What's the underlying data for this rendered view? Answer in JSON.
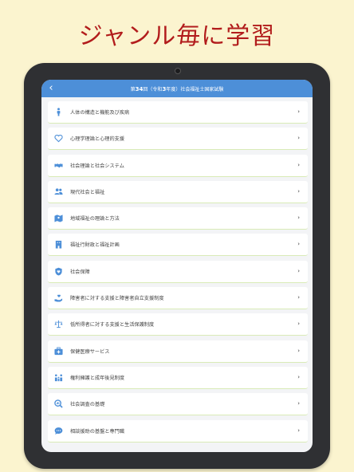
{
  "headline": "ジャンル毎に学習",
  "navbar": {
    "back_glyph": "‹",
    "title_prefix": "第",
    "title_num1": "34",
    "title_mid": "回（令和",
    "title_num2": "3",
    "title_suffix": "年度）社会福祉士国家試験"
  },
  "accent_color": "#4d8fd8",
  "chevron": "›",
  "items": [
    {
      "label": "人体の構造と機能及び疾病",
      "icon": "person-icon"
    },
    {
      "label": "心理学理論と心理的支援",
      "icon": "heart-icon"
    },
    {
      "label": "社会理論と社会システム",
      "icon": "handshake-icon"
    },
    {
      "label": "現代社会と福祉",
      "icon": "people-icon"
    },
    {
      "label": "地域福祉の理論と方法",
      "icon": "map-icon"
    },
    {
      "label": "福祉行財政と福祉計画",
      "icon": "building-icon"
    },
    {
      "label": "社会保障",
      "icon": "shield-heart-icon"
    },
    {
      "label": "障害者に対する支援と障害者自立支援制度",
      "icon": "hand-heart-icon"
    },
    {
      "label": "低所得者に対する支援と生活保護制度",
      "icon": "scale-icon"
    },
    {
      "label": "保健医療サービス",
      "icon": "medical-kit-icon"
    },
    {
      "label": "権利擁護と成年後見制度",
      "icon": "family-icon"
    },
    {
      "label": "社会調査の基礎",
      "icon": "search-chart-icon"
    },
    {
      "label": "相談援助の基盤と専門職",
      "icon": "chat-icon"
    }
  ]
}
